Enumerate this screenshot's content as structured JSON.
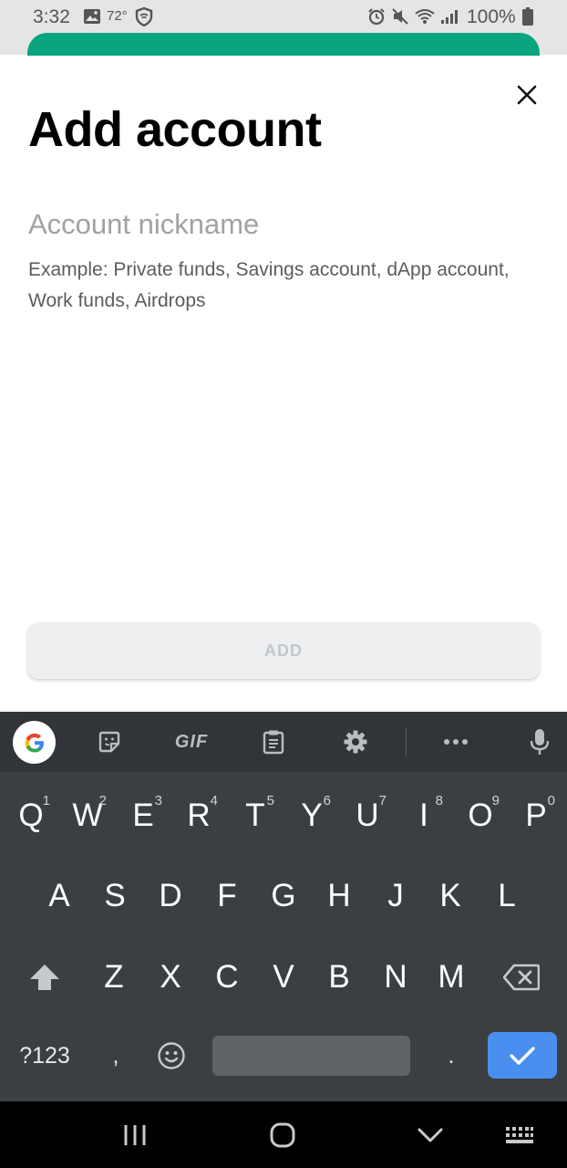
{
  "status_bar": {
    "time": "3:32",
    "temperature": "72°",
    "battery": "100%",
    "icons": [
      "image-icon",
      "shield-wifi-icon",
      "alarm-icon",
      "mute-icon",
      "wifi-icon",
      "signal-icon",
      "battery-icon"
    ]
  },
  "sheet": {
    "title": "Add account",
    "close_icon": "close-icon",
    "nickname_placeholder": "Account nickname",
    "nickname_value": "",
    "helper_text": "Example: Private funds, Savings account, dApp account, Work funds, Airdrops",
    "add_button_label": "ADD"
  },
  "keyboard": {
    "toolbar": [
      "google-icon",
      "sticker-icon",
      "GIF",
      "clipboard-icon",
      "gear-icon",
      "more-icon",
      "mic-icon"
    ],
    "row1": [
      {
        "key": "Q",
        "hint": "1"
      },
      {
        "key": "W",
        "hint": "2"
      },
      {
        "key": "E",
        "hint": "3"
      },
      {
        "key": "R",
        "hint": "4"
      },
      {
        "key": "T",
        "hint": "5"
      },
      {
        "key": "Y",
        "hint": "6"
      },
      {
        "key": "U",
        "hint": "7"
      },
      {
        "key": "I",
        "hint": "8"
      },
      {
        "key": "O",
        "hint": "9"
      },
      {
        "key": "P",
        "hint": "0"
      }
    ],
    "row2": [
      "A",
      "S",
      "D",
      "F",
      "G",
      "H",
      "J",
      "K",
      "L"
    ],
    "row3": [
      "Z",
      "X",
      "C",
      "V",
      "B",
      "N",
      "M"
    ],
    "row4": {
      "symbols": "?123",
      "comma": ",",
      "period": "."
    }
  },
  "nav_bar": {
    "icons": [
      "recents-icon",
      "home-icon",
      "back-icon",
      "keyboard-switch-icon"
    ]
  },
  "colors": {
    "accent_teal": "#0aa57f",
    "keyboard_bg": "#3b3f44",
    "enter_blue": "#4a8ff0"
  }
}
